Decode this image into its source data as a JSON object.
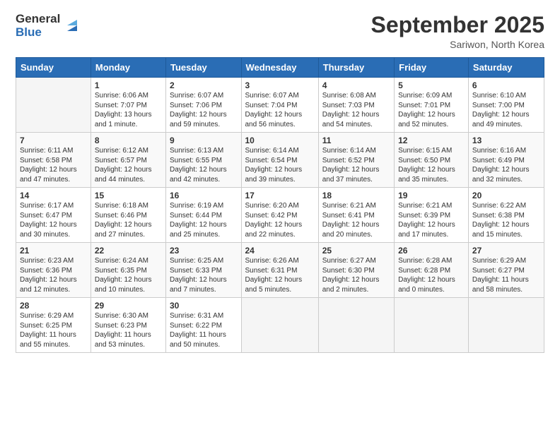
{
  "logo": {
    "general": "General",
    "blue": "Blue"
  },
  "title": {
    "month": "September 2025",
    "location": "Sariwon, North Korea"
  },
  "days_of_week": [
    "Sunday",
    "Monday",
    "Tuesday",
    "Wednesday",
    "Thursday",
    "Friday",
    "Saturday"
  ],
  "weeks": [
    [
      {
        "day": "",
        "info": ""
      },
      {
        "day": "1",
        "info": "Sunrise: 6:06 AM\nSunset: 7:07 PM\nDaylight: 13 hours and 1 minute."
      },
      {
        "day": "2",
        "info": "Sunrise: 6:07 AM\nSunset: 7:06 PM\nDaylight: 12 hours and 59 minutes."
      },
      {
        "day": "3",
        "info": "Sunrise: 6:07 AM\nSunset: 7:04 PM\nDaylight: 12 hours and 56 minutes."
      },
      {
        "day": "4",
        "info": "Sunrise: 6:08 AM\nSunset: 7:03 PM\nDaylight: 12 hours and 54 minutes."
      },
      {
        "day": "5",
        "info": "Sunrise: 6:09 AM\nSunset: 7:01 PM\nDaylight: 12 hours and 52 minutes."
      },
      {
        "day": "6",
        "info": "Sunrise: 6:10 AM\nSunset: 7:00 PM\nDaylight: 12 hours and 49 minutes."
      }
    ],
    [
      {
        "day": "7",
        "info": "Sunrise: 6:11 AM\nSunset: 6:58 PM\nDaylight: 12 hours and 47 minutes."
      },
      {
        "day": "8",
        "info": "Sunrise: 6:12 AM\nSunset: 6:57 PM\nDaylight: 12 hours and 44 minutes."
      },
      {
        "day": "9",
        "info": "Sunrise: 6:13 AM\nSunset: 6:55 PM\nDaylight: 12 hours and 42 minutes."
      },
      {
        "day": "10",
        "info": "Sunrise: 6:14 AM\nSunset: 6:54 PM\nDaylight: 12 hours and 39 minutes."
      },
      {
        "day": "11",
        "info": "Sunrise: 6:14 AM\nSunset: 6:52 PM\nDaylight: 12 hours and 37 minutes."
      },
      {
        "day": "12",
        "info": "Sunrise: 6:15 AM\nSunset: 6:50 PM\nDaylight: 12 hours and 35 minutes."
      },
      {
        "day": "13",
        "info": "Sunrise: 6:16 AM\nSunset: 6:49 PM\nDaylight: 12 hours and 32 minutes."
      }
    ],
    [
      {
        "day": "14",
        "info": "Sunrise: 6:17 AM\nSunset: 6:47 PM\nDaylight: 12 hours and 30 minutes."
      },
      {
        "day": "15",
        "info": "Sunrise: 6:18 AM\nSunset: 6:46 PM\nDaylight: 12 hours and 27 minutes."
      },
      {
        "day": "16",
        "info": "Sunrise: 6:19 AM\nSunset: 6:44 PM\nDaylight: 12 hours and 25 minutes."
      },
      {
        "day": "17",
        "info": "Sunrise: 6:20 AM\nSunset: 6:42 PM\nDaylight: 12 hours and 22 minutes."
      },
      {
        "day": "18",
        "info": "Sunrise: 6:21 AM\nSunset: 6:41 PM\nDaylight: 12 hours and 20 minutes."
      },
      {
        "day": "19",
        "info": "Sunrise: 6:21 AM\nSunset: 6:39 PM\nDaylight: 12 hours and 17 minutes."
      },
      {
        "day": "20",
        "info": "Sunrise: 6:22 AM\nSunset: 6:38 PM\nDaylight: 12 hours and 15 minutes."
      }
    ],
    [
      {
        "day": "21",
        "info": "Sunrise: 6:23 AM\nSunset: 6:36 PM\nDaylight: 12 hours and 12 minutes."
      },
      {
        "day": "22",
        "info": "Sunrise: 6:24 AM\nSunset: 6:35 PM\nDaylight: 12 hours and 10 minutes."
      },
      {
        "day": "23",
        "info": "Sunrise: 6:25 AM\nSunset: 6:33 PM\nDaylight: 12 hours and 7 minutes."
      },
      {
        "day": "24",
        "info": "Sunrise: 6:26 AM\nSunset: 6:31 PM\nDaylight: 12 hours and 5 minutes."
      },
      {
        "day": "25",
        "info": "Sunrise: 6:27 AM\nSunset: 6:30 PM\nDaylight: 12 hours and 2 minutes."
      },
      {
        "day": "26",
        "info": "Sunrise: 6:28 AM\nSunset: 6:28 PM\nDaylight: 12 hours and 0 minutes."
      },
      {
        "day": "27",
        "info": "Sunrise: 6:29 AM\nSunset: 6:27 PM\nDaylight: 11 hours and 58 minutes."
      }
    ],
    [
      {
        "day": "28",
        "info": "Sunrise: 6:29 AM\nSunset: 6:25 PM\nDaylight: 11 hours and 55 minutes."
      },
      {
        "day": "29",
        "info": "Sunrise: 6:30 AM\nSunset: 6:23 PM\nDaylight: 11 hours and 53 minutes."
      },
      {
        "day": "30",
        "info": "Sunrise: 6:31 AM\nSunset: 6:22 PM\nDaylight: 11 hours and 50 minutes."
      },
      {
        "day": "",
        "info": ""
      },
      {
        "day": "",
        "info": ""
      },
      {
        "day": "",
        "info": ""
      },
      {
        "day": "",
        "info": ""
      }
    ]
  ]
}
